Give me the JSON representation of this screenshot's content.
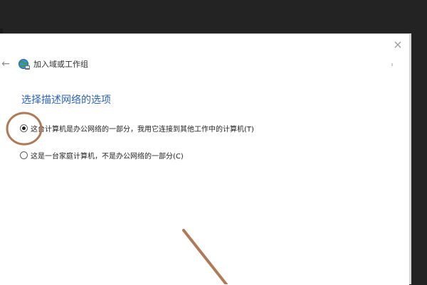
{
  "dialog": {
    "header_title": "加入域或工作组",
    "back_icon": "back-arrow-icon",
    "close_icon": "close-icon",
    "wizard_icon": "network-globe-icon",
    "close_glyph": "×",
    "back_glyph": "←"
  },
  "page": {
    "heading": "选择描述网络的选项"
  },
  "options": [
    {
      "label": "这台计算机是办公网络的一部分，我用它连接到其他工作中的计算机(T)",
      "selected": true
    },
    {
      "label": "这是一台家庭计算机，不是办公网络的一部分(C)",
      "selected": false
    }
  ],
  "colors": {
    "heading": "#2e63b8",
    "annotation": "#b07a57",
    "backdrop": "#232323"
  }
}
